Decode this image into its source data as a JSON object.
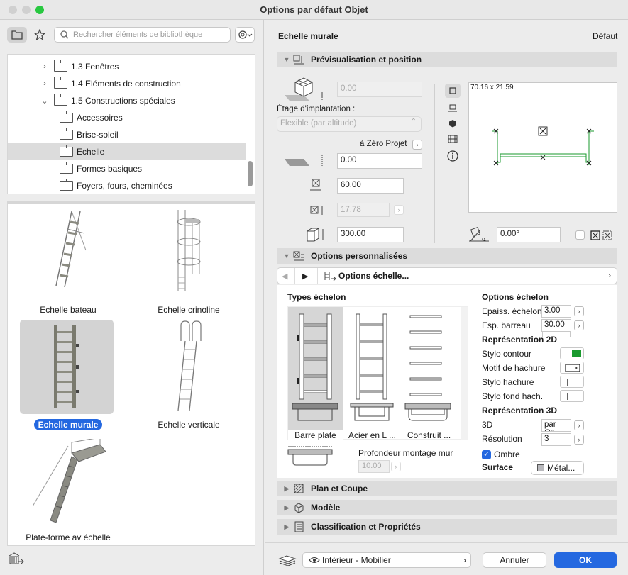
{
  "window": {
    "title": "Options par défaut Objet"
  },
  "search": {
    "placeholder": "Rechercher éléments de bibliothèque"
  },
  "tree": {
    "items": [
      {
        "label": "1.3 Fenêtres",
        "level": 1,
        "expander": "›"
      },
      {
        "label": "1.4 Eléments de construction",
        "level": 1,
        "expander": "›"
      },
      {
        "label": "1.5 Constructions spéciales",
        "level": 1,
        "expander": "⌄"
      },
      {
        "label": "Accessoires",
        "level": 2
      },
      {
        "label": "Brise-soleil",
        "level": 2
      },
      {
        "label": "Echelle",
        "level": 2,
        "selected": true
      },
      {
        "label": "Formes basiques",
        "level": 2
      },
      {
        "label": "Foyers, fours, cheminées",
        "level": 2
      }
    ]
  },
  "gallery": {
    "items": [
      {
        "label": "Echelle bateau"
      },
      {
        "label": "Echelle crinoline"
      },
      {
        "label": "Echelle murale",
        "selected": true
      },
      {
        "label": "Echelle verticale"
      },
      {
        "label": "Plate-forme av échelle"
      }
    ]
  },
  "header": {
    "object_name": "Echelle murale",
    "default_label": "Défaut"
  },
  "preview": {
    "section_title": "Prévisualisation et position",
    "elevation_value": "0.00",
    "storey_label": "Étage d'implantation :",
    "storey_select": "Flexible (par altitude)",
    "reference_label": "à Zéro Projet",
    "offset_value": "0.00",
    "width_value": "60.00",
    "depth_value": "17.78",
    "height_value": "300.00",
    "dimensions_text": "70.16 x 21.59",
    "angle_value": "0.00°"
  },
  "custom": {
    "section_title": "Options personnalisées",
    "page_select": "Options échelle...",
    "types_title": "Types échelon",
    "types": [
      {
        "label": "Barre plate",
        "selected": true
      },
      {
        "label": "Acier en L ..."
      },
      {
        "label": "Construit ..."
      }
    ],
    "mount_depth_label": "Profondeur montage mur",
    "mount_depth_value": "10.00",
    "rung_options_title": "Options échelon",
    "rung_thickness_label": "Epaiss. échelon",
    "rung_thickness_value": "3.00",
    "rung_spacing_label": "Esp. barreau",
    "rung_spacing_value": "30.00",
    "rep2d_title": "Représentation 2D",
    "contour_pen_label": "Stylo contour",
    "hatch_pattern_label": "Motif de hachure",
    "hatch_pen_label": "Stylo hachure",
    "hatch_bg_pen_label": "Stylo fond hach.",
    "rep3d_title": "Représentation 3D",
    "label_3d": "3D",
    "value_3d": "par Op",
    "resolution_label": "Résolution",
    "resolution_value": "3",
    "shadow_label": "Ombre",
    "surface_label": "Surface",
    "surface_value": "Métal..."
  },
  "sections": {
    "plan": "Plan et Coupe",
    "model": "Modèle",
    "classification": "Classification et Propriétés"
  },
  "footer": {
    "layer": "Intérieur - Mobilier",
    "cancel": "Annuler",
    "ok": "OK"
  },
  "colors": {
    "accent": "#2468e0",
    "contour_pen": "#1a9a2e"
  }
}
